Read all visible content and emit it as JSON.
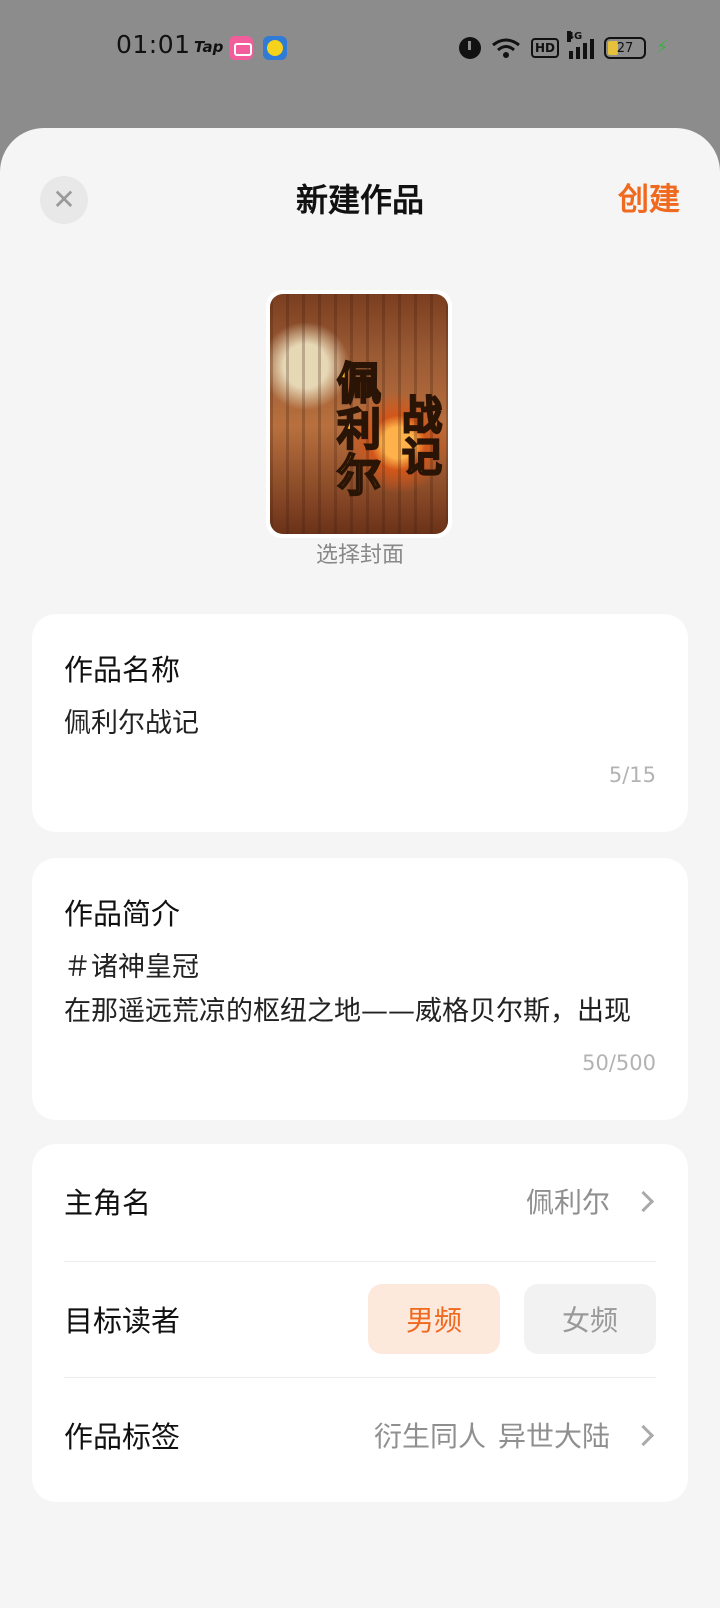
{
  "status_bar": {
    "time": "01:01",
    "tap_label": "Tap",
    "battery_level": "27",
    "network_label": "4G",
    "hd_label": "HD"
  },
  "header": {
    "title": "新建作品",
    "close_symbol": "✕",
    "create_label": "创建"
  },
  "cover": {
    "title_part1": "佩利尔",
    "title_part2": "战记",
    "caption": "选择封面"
  },
  "name_field": {
    "label": "作品名称",
    "value": "佩利尔战记",
    "counter": "5/15"
  },
  "intro_field": {
    "label": "作品简介",
    "line1": "＃诸神皇冠",
    "line2": "在那遥远荒凉的枢纽之地——威格贝尔斯，出现",
    "counter": "50/500"
  },
  "meta": {
    "protagonist_label": "主角名",
    "protagonist_value": "佩利尔",
    "reader_label": "目标读者",
    "reader_options": [
      "男频",
      "女频"
    ],
    "reader_selected": "男频",
    "tags_label": "作品标签",
    "tags": [
      "衍生同人",
      "异世大陆"
    ]
  },
  "colors": {
    "accent": "#ef6a1f",
    "selected_bg": "#fde8dc",
    "page_bg": "#f5f5f5"
  }
}
